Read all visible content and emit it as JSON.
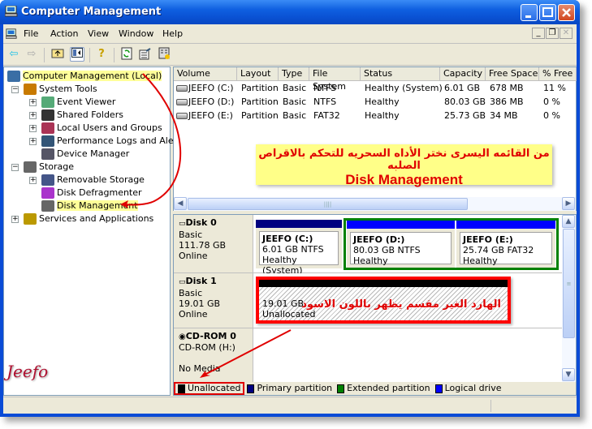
{
  "window": {
    "title": "Computer Management",
    "controls": {
      "minimize": "minimize-icon",
      "maximize": "maximize-icon",
      "close": "close-icon"
    }
  },
  "menubar": {
    "items": [
      "File",
      "Action",
      "View",
      "Window",
      "Help"
    ],
    "mdi_controls": [
      "_",
      "❐",
      "✕"
    ]
  },
  "toolbar": {
    "buttons": [
      "back-arrow",
      "forward-arrow",
      "up-folder",
      "show-hide-tree",
      "help",
      "refresh",
      "export-list",
      "properties"
    ]
  },
  "tree": {
    "items": [
      {
        "label": "Computer Management (Local)",
        "level": 0,
        "highlighted": true,
        "icon": "computer-icon"
      },
      {
        "label": "System Tools",
        "level": 1,
        "expander": "−",
        "icon": "tools-icon"
      },
      {
        "label": "Event Viewer",
        "level": 2,
        "expander": "+",
        "icon": "event-viewer-icon"
      },
      {
        "label": "Shared Folders",
        "level": 2,
        "expander": "+",
        "icon": "shared-folder-icon"
      },
      {
        "label": "Local Users and Groups",
        "level": 2,
        "expander": "+",
        "icon": "users-icon"
      },
      {
        "label": "Performance Logs and Alerts",
        "level": 2,
        "expander": "+",
        "icon": "performance-icon"
      },
      {
        "label": "Device Manager",
        "level": 2,
        "expander": "",
        "icon": "device-manager-icon"
      },
      {
        "label": "Storage",
        "level": 1,
        "expander": "−",
        "icon": "storage-icon"
      },
      {
        "label": "Removable Storage",
        "level": 2,
        "expander": "+",
        "icon": "removable-storage-icon"
      },
      {
        "label": "Disk Defragmenter",
        "level": 2,
        "expander": "",
        "icon": "defrag-icon"
      },
      {
        "label": "Disk Management",
        "level": 2,
        "expander": "",
        "highlighted": true,
        "icon": "disk-management-icon"
      },
      {
        "label": "Services and Applications",
        "level": 1,
        "expander": "+",
        "icon": "services-icon"
      }
    ]
  },
  "volumes": {
    "columns": [
      "Volume",
      "Layout",
      "Type",
      "File System",
      "Status",
      "Capacity",
      "Free Space",
      "% Free"
    ],
    "rows": [
      [
        "JEEFO (C:)",
        "Partition",
        "Basic",
        "NTFS",
        "Healthy (System)",
        "6.01 GB",
        "678 MB",
        "11 %"
      ],
      [
        "JEEFO (D:)",
        "Partition",
        "Basic",
        "NTFS",
        "Healthy",
        "80.03 GB",
        "386 MB",
        "0 %"
      ],
      [
        "JEEFO (E:)",
        "Partition",
        "Basic",
        "FAT32",
        "Healthy",
        "25.73 GB",
        "34 MB",
        "0 %"
      ]
    ]
  },
  "annotation_top": {
    "arabic": "من القائمه اليسرى نختر الأداه السحريه للتحكم بالاقراص الصلبه",
    "english": "Disk Management"
  },
  "disks": [
    {
      "name": "Disk 0",
      "type": "Basic",
      "size": "111.78 GB",
      "state": "Online",
      "partitions": [
        {
          "name": "JEEFO  (C:)",
          "detail": "6.01 GB NTFS",
          "status": "Healthy (System)",
          "kind": "primary"
        },
        {
          "name": "JEEFO  (D:)",
          "detail": "80.03 GB NTFS",
          "status": "Healthy",
          "kind": "logical"
        },
        {
          "name": "JEEFO  (E:)",
          "detail": "25.74 GB FAT32",
          "status": "Healthy",
          "kind": "logical"
        }
      ]
    },
    {
      "name": "Disk 1",
      "type": "Basic",
      "size": "19.01 GB",
      "state": "Online",
      "unallocated": {
        "size": "19.01 GB",
        "label": "Unallocated",
        "note_ar": "الهارد الغير مقسم يظهر باللون الاسود"
      }
    },
    {
      "name": "CD-ROM 0",
      "type": "CD-ROM (H:)",
      "state": "No Media"
    }
  ],
  "legend": [
    {
      "label": "Unallocated",
      "color": "#000000"
    },
    {
      "label": "Primary partition",
      "color": "#000080"
    },
    {
      "label": "Extended partition",
      "color": "#008000"
    },
    {
      "label": "Logical drive",
      "color": "#0000ff"
    }
  ],
  "colors": {
    "primary": "#000080",
    "logical": "#0000ff",
    "extended": "#008000",
    "unallocated": "#000000",
    "annotation": "#ff0000"
  },
  "signature": "Jeefo"
}
